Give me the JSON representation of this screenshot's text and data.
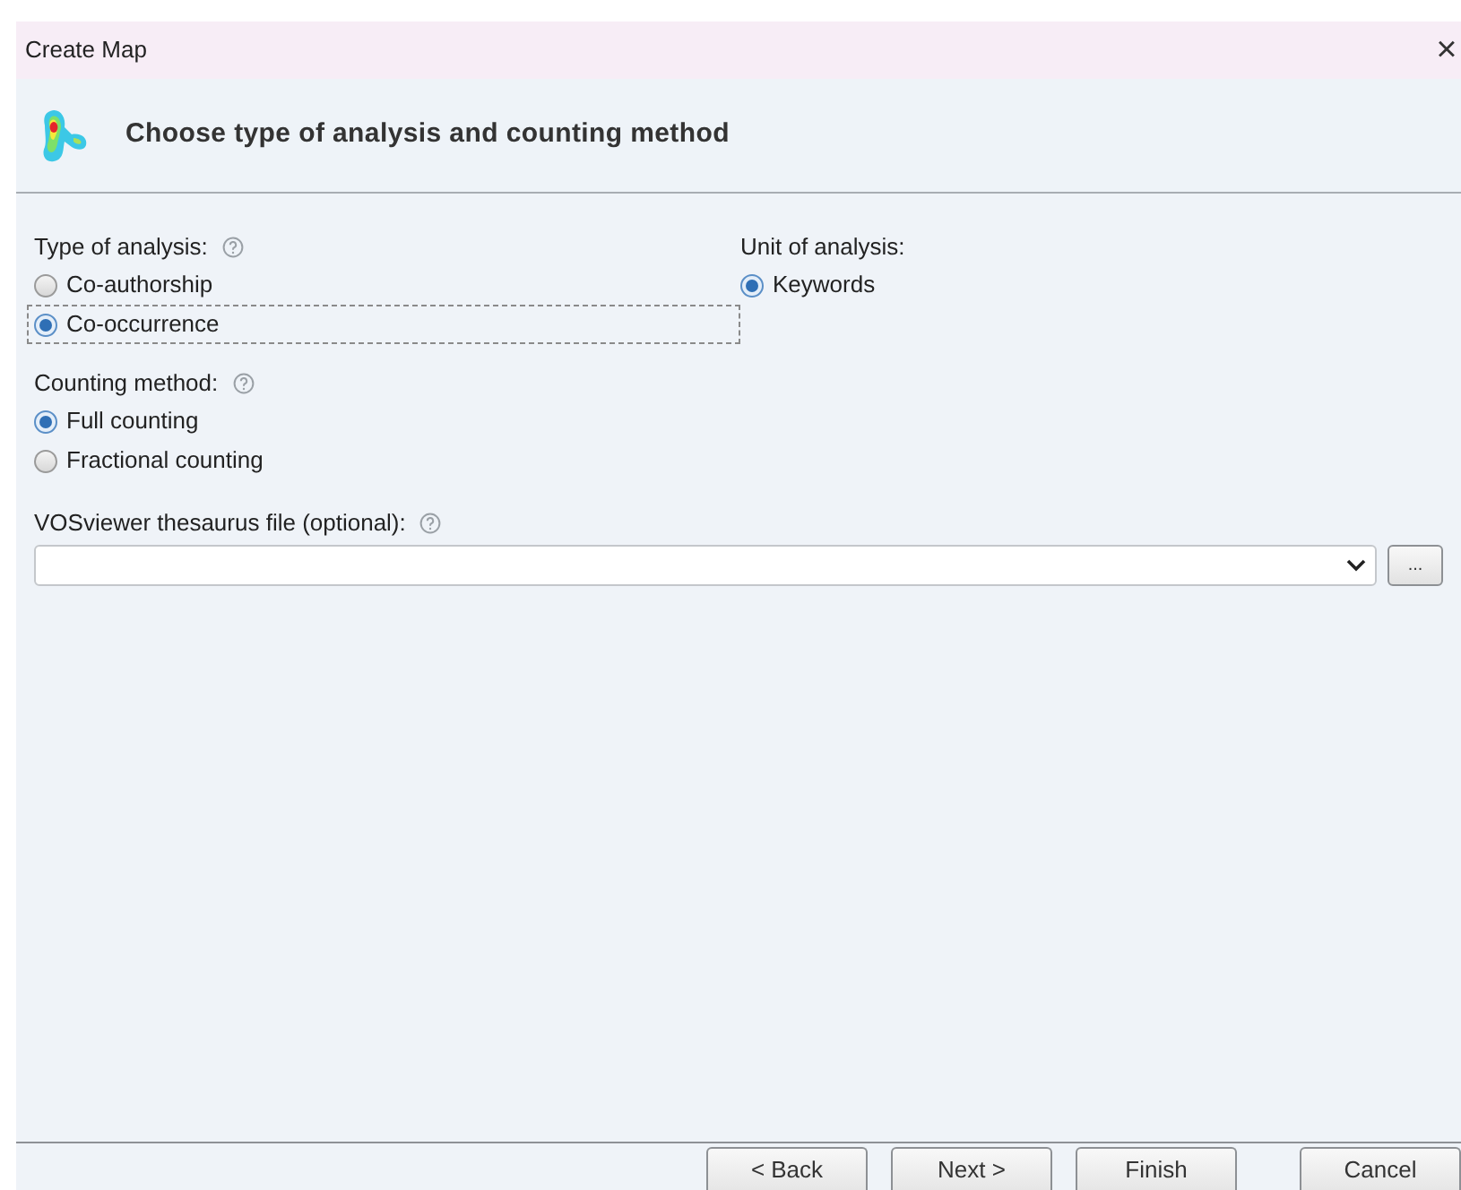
{
  "window": {
    "title": "Create Map",
    "close": "×"
  },
  "header": {
    "title": "Choose type of analysis and counting method"
  },
  "analysis_type": {
    "label": "Type of analysis:",
    "options": [
      {
        "label": "Co-authorship",
        "selected": false
      },
      {
        "label": "Co-occurrence",
        "selected": true
      }
    ]
  },
  "unit": {
    "label": "Unit of analysis:",
    "options": [
      {
        "label": "Keywords",
        "selected": true
      }
    ]
  },
  "counting": {
    "label": "Counting method:",
    "options": [
      {
        "label": "Full counting",
        "selected": true
      },
      {
        "label": "Fractional counting",
        "selected": false
      }
    ]
  },
  "thesaurus": {
    "label": "VOSviewer thesaurus file (optional):",
    "browse": "..."
  },
  "buttons": [
    "< Back",
    "Next >",
    "Finish",
    "Cancel"
  ]
}
